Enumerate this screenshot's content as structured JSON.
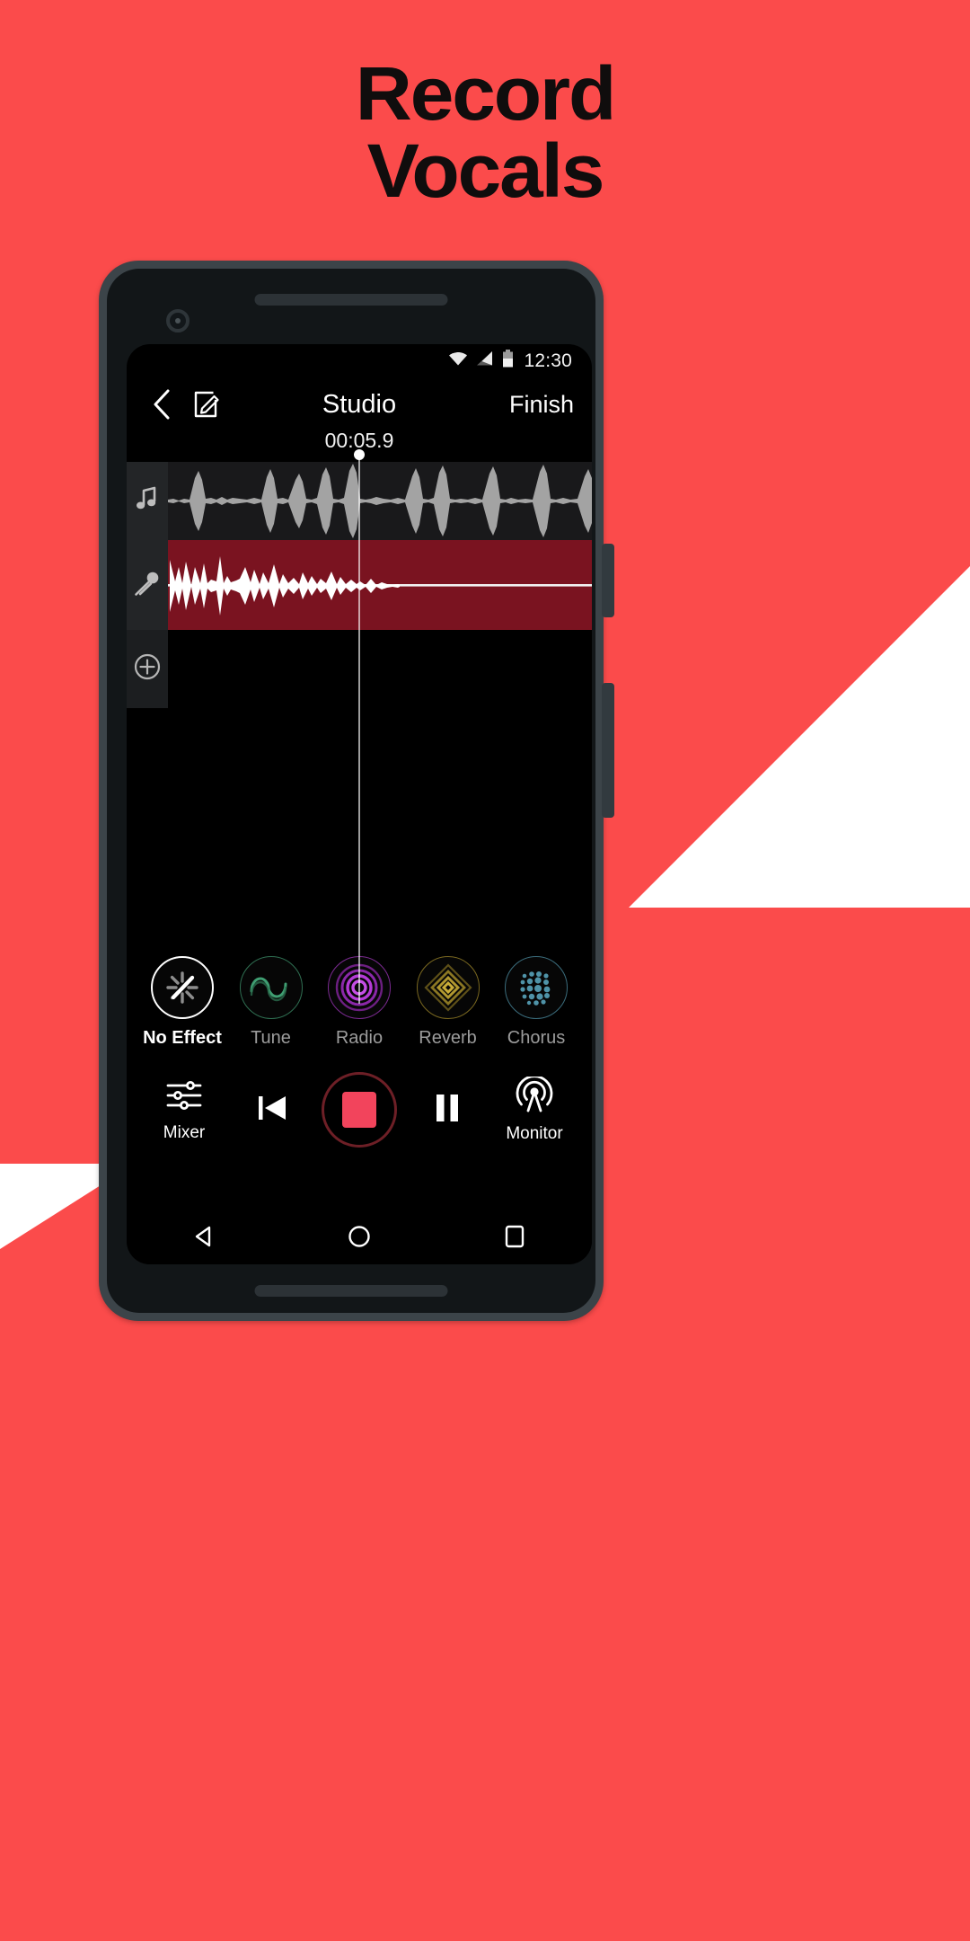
{
  "promo": {
    "headline_line1": "Record",
    "headline_line2": "Vocals",
    "bg_color": "#fb4b4b",
    "headline_color": "#100d0d"
  },
  "status_bar": {
    "wifi_icon": "wifi-icon",
    "signal_icon": "cellular-signal-icon",
    "battery_icon": "battery-icon",
    "clock": "12:30"
  },
  "header": {
    "back_icon": "chevron-left-icon",
    "edit_icon": "edit-compose-icon",
    "title": "Studio",
    "finish_label": "Finish",
    "timer": "00:05.9"
  },
  "tracks": [
    {
      "name": "music-track",
      "icon": "music-note-icon",
      "waveform_color": "#a3a3a3",
      "body_color": "#19191b"
    },
    {
      "name": "vocal-track",
      "icon": "microphone-icon",
      "waveform_color": "#ffffff",
      "body_color": "#7a1320"
    },
    {
      "name": "add-track",
      "icon": "plus-circle-icon",
      "body_color": "#000000"
    }
  ],
  "effects": {
    "selected": "No Effect",
    "items": [
      {
        "label": "No Effect",
        "icon": "no-effect-icon",
        "color": "#ffffff"
      },
      {
        "label": "Tune",
        "icon": "tune-wave-icon",
        "color": "#3f9e72"
      },
      {
        "label": "Radio",
        "icon": "radio-rings-icon",
        "color": "#b43bd6"
      },
      {
        "label": "Reverb",
        "icon": "reverb-diamond-icon",
        "color": "#b0972f"
      },
      {
        "label": "Chorus",
        "icon": "chorus-dots-icon",
        "color": "#4f93a8"
      }
    ]
  },
  "transport": {
    "mixer_label": "Mixer",
    "mixer_icon": "mixer-sliders-icon",
    "rewind_icon": "skip-to-start-icon",
    "record_icon": "stop-square-icon",
    "record_color": "#f2445c",
    "pause_icon": "pause-icon",
    "monitor_label": "Monitor",
    "monitor_icon": "monitor-broadcast-icon"
  },
  "navbar": {
    "back_icon": "android-back-icon",
    "home_icon": "android-home-icon",
    "recents_icon": "android-recents-icon"
  }
}
